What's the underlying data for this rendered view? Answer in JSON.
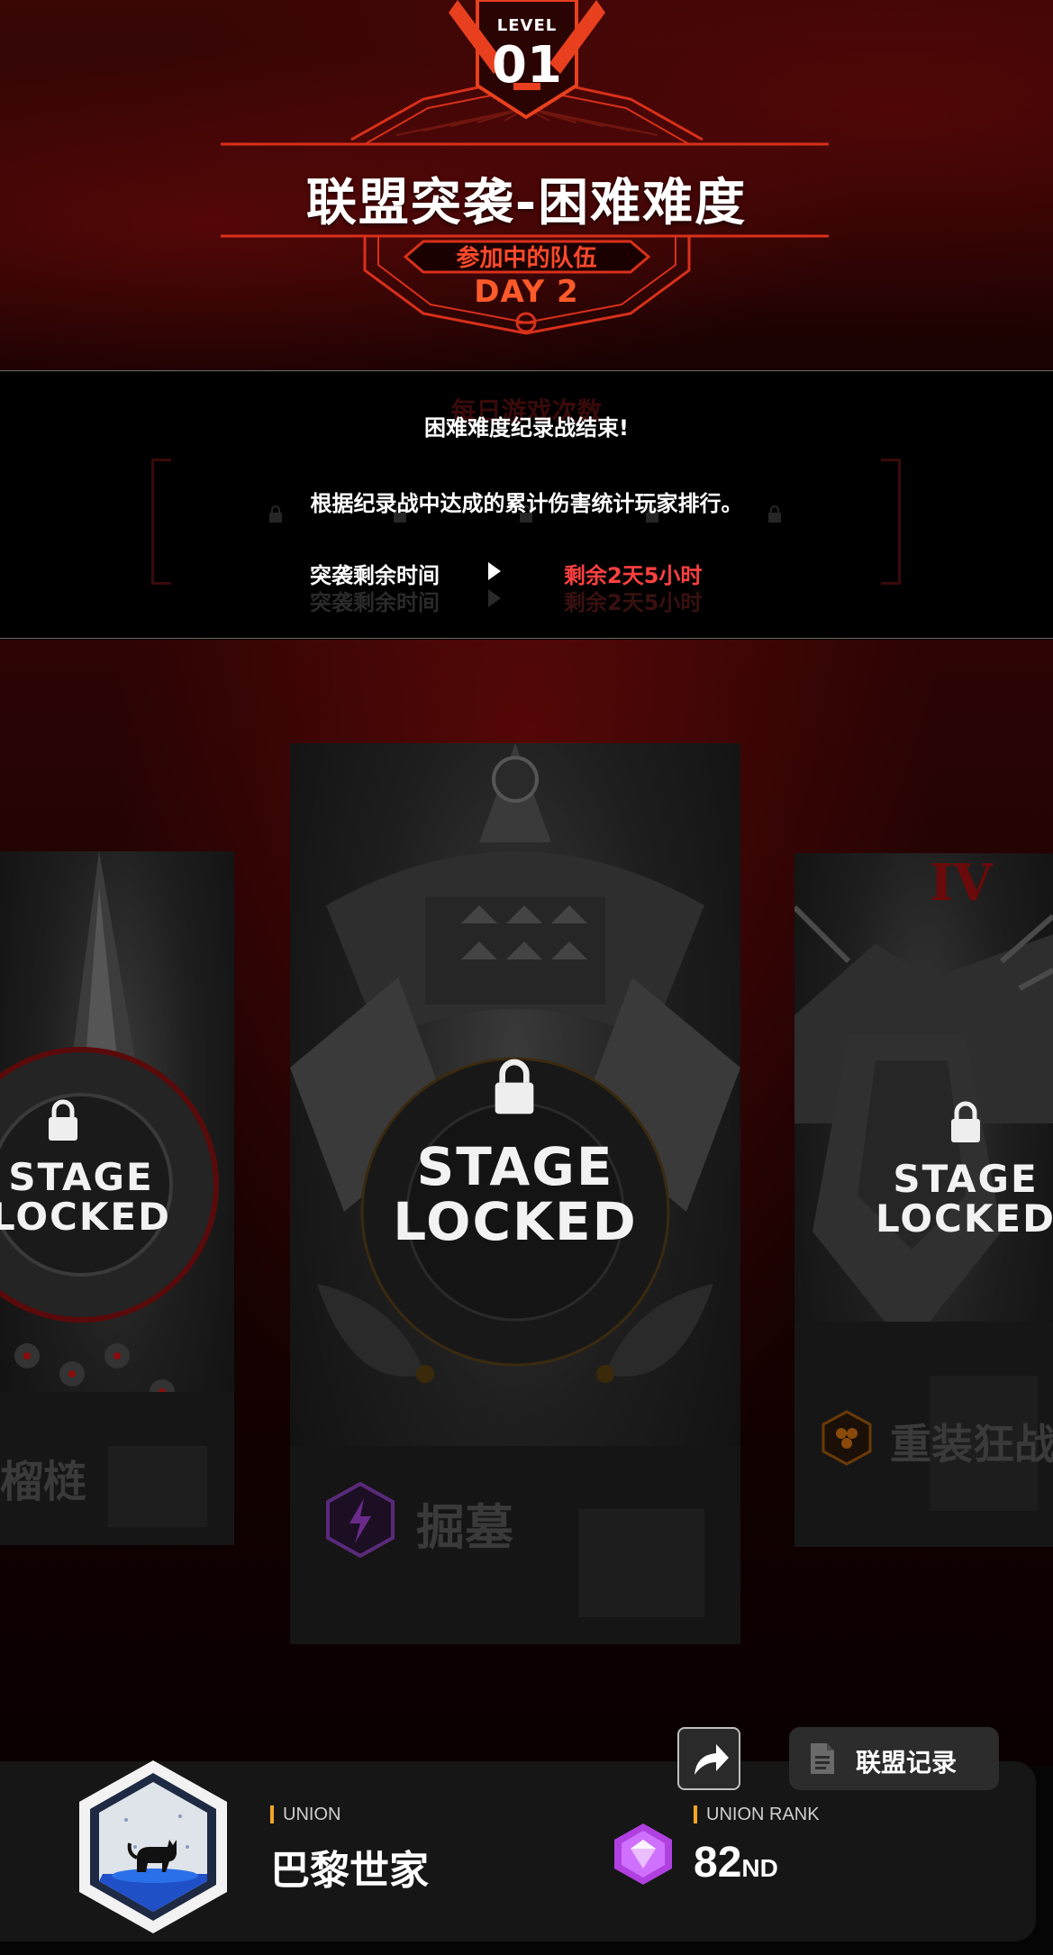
{
  "header": {
    "level_label": "LEVEL",
    "level_number": "01",
    "title": "联盟突袭-困难难度",
    "subtitle": "参加中的队伍",
    "day": "DAY 2"
  },
  "info": {
    "ghost_text": "每日游戏次数",
    "message_1": "困难难度纪录战结束!",
    "message_2": "根据纪录战中达成的累计伤害统计玩家排行。",
    "time_label": "突袭剩余时间",
    "time_value": "剩余2天5小时"
  },
  "stages": [
    {
      "locked_line1": "STAGE",
      "locked_line2": "LOCKED",
      "boss_name": "榴梿",
      "status": "locked"
    },
    {
      "locked_line1": "STAGE",
      "locked_line2": "LOCKED",
      "boss_name": "掘墓",
      "element_icon": "lightning-icon",
      "element_color": "#6a2a8a",
      "status": "locked"
    },
    {
      "locked_line1": "STAGE",
      "locked_line2": "LOCKED",
      "boss_name": "重装狂战",
      "roman": "IV",
      "element_icon": "hexagon-cluster-icon",
      "element_color": "#a0500a",
      "status": "locked"
    }
  ],
  "actions": {
    "share_icon": "share-arrow-icon",
    "record_label": "联盟记录",
    "record_icon": "document-icon"
  },
  "union": {
    "tag": "UNION",
    "name": "巴黎世家",
    "emblem_icon": "cat-emblem-icon",
    "rank_tag": "UNION RANK",
    "rank": "82",
    "rank_suffix": "ND",
    "rank_icon": "purple-gem-icon"
  },
  "colors": {
    "accent_red": "#ff4a2a",
    "time_red": "#ff4040",
    "tag_orange": "#f5a623",
    "gem_purple": "#b040e0"
  }
}
